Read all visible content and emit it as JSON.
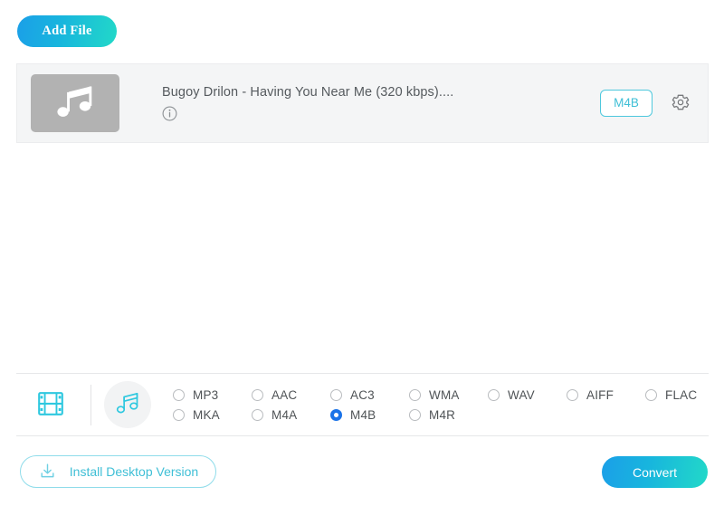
{
  "toolbar": {
    "add_file_label": "Add File"
  },
  "file_list": {
    "rows": [
      {
        "name": "Bugoy Drilon - Having You Near Me (320 kbps)....",
        "format_badge": "M4B",
        "thumb_icon": "music-note-icon",
        "info_icon": "info-icon",
        "settings_icon": "gear-icon"
      }
    ]
  },
  "format_bar": {
    "tabs": [
      {
        "id": "video",
        "icon": "film-strip-icon",
        "active": false
      },
      {
        "id": "audio",
        "icon": "music-note-icon",
        "active": true
      }
    ],
    "rows": [
      [
        {
          "label": "MP3",
          "selected": false
        },
        {
          "label": "AAC",
          "selected": false
        },
        {
          "label": "AC3",
          "selected": false
        },
        {
          "label": "WMA",
          "selected": false
        },
        {
          "label": "WAV",
          "selected": false
        },
        {
          "label": "AIFF",
          "selected": false
        },
        {
          "label": "FLAC",
          "selected": false
        }
      ],
      [
        {
          "label": "MKA",
          "selected": false
        },
        {
          "label": "M4A",
          "selected": false
        },
        {
          "label": "M4B",
          "selected": true
        },
        {
          "label": "M4R",
          "selected": false
        }
      ]
    ]
  },
  "bottom_bar": {
    "install_label": "Install Desktop Version",
    "install_icon": "download-icon",
    "convert_label": "Convert"
  },
  "colors": {
    "accent_gradient_start": "#1b9fe8",
    "accent_gradient_end": "#22d9c8",
    "teal": "#3fbfd6",
    "radio_selected": "#1a73e8",
    "row_background": "#f4f5f6",
    "thumb_background": "#b2b2b2"
  }
}
